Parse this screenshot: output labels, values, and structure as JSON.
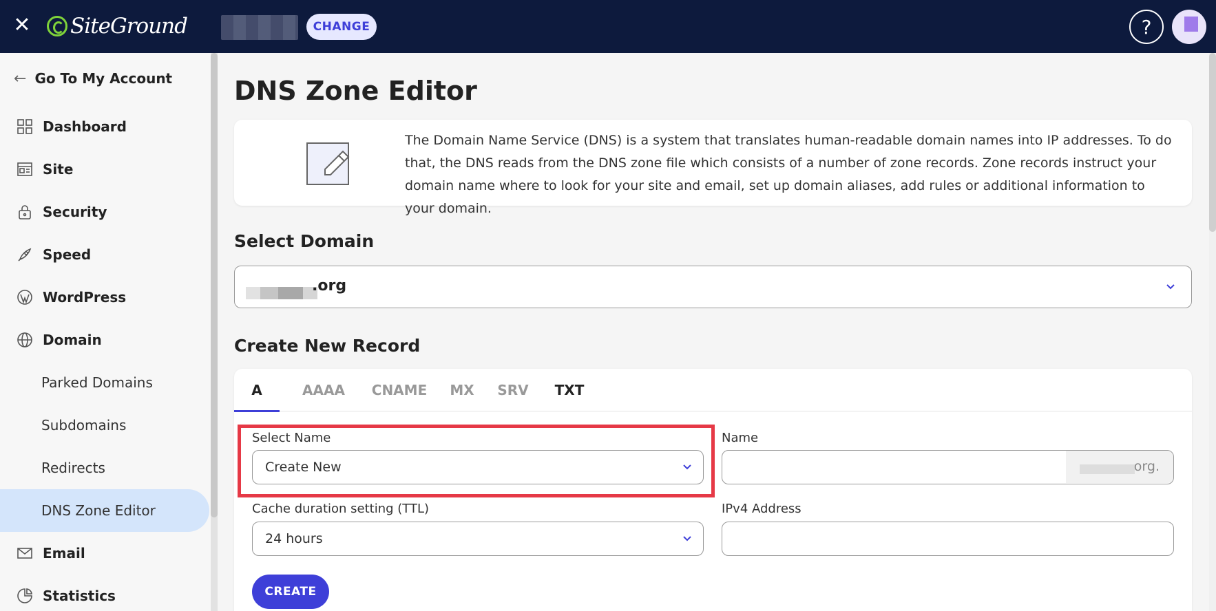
{
  "topbar": {
    "logo_text": "SiteGround",
    "change_label": "CHANGE",
    "help_label": "?"
  },
  "sidebar": {
    "back_label": "Go To My Account",
    "items": [
      {
        "label": "Dashboard",
        "icon": "dashboard-icon"
      },
      {
        "label": "Site",
        "icon": "site-icon"
      },
      {
        "label": "Security",
        "icon": "lock-icon"
      },
      {
        "label": "Speed",
        "icon": "rocket-icon"
      },
      {
        "label": "WordPress",
        "icon": "wordpress-icon"
      },
      {
        "label": "Domain",
        "icon": "globe-icon"
      }
    ],
    "sub_items": [
      "Parked Domains",
      "Subdomains",
      "Redirects",
      "DNS Zone Editor"
    ],
    "after_items": [
      {
        "label": "Email",
        "icon": "mail-icon"
      },
      {
        "label": "Statistics",
        "icon": "pie-chart-icon"
      }
    ]
  },
  "main": {
    "title": "DNS Zone Editor",
    "description": "The Domain Name Service (DNS) is a system that translates human-readable domain names into IP addresses. To do that, the DNS reads from the DNS zone file which consists of a number of zone records. Zone records instruct your domain name where to look for your site and email, set up domain aliases, add rules or additional information to your domain.",
    "select_domain_heading": "Select Domain",
    "selected_domain": ".org",
    "create_record_heading": "Create New Record",
    "tabs": [
      "A",
      "AAAA",
      "CNAME",
      "MX",
      "SRV",
      "TXT"
    ],
    "active_tab": "A",
    "form": {
      "select_name_label": "Select Name",
      "select_name_value": "Create New",
      "name_label": "Name",
      "name_value": "",
      "name_suffix": "org.",
      "ttl_label": "Cache duration setting (TTL)",
      "ttl_value": "24 hours",
      "ipv4_label": "IPv4 Address",
      "ipv4_value": "",
      "create_label": "CREATE"
    }
  },
  "colors": {
    "topbar": "#0d1a3d",
    "accent": "#3e3fd8",
    "highlight": "#e63946",
    "active_nav": "#d4e5fb"
  }
}
